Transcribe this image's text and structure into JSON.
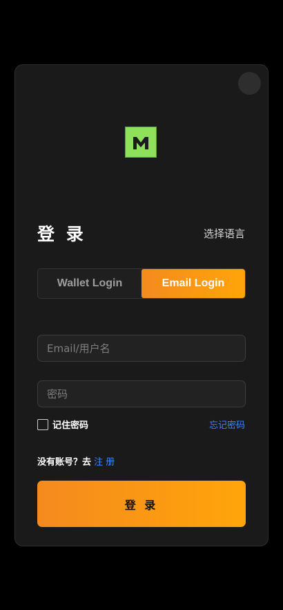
{
  "header": {
    "title": "登 录",
    "language_label": "选择语言"
  },
  "tabs": [
    {
      "label": "Wallet Login",
      "active": false
    },
    {
      "label": "Email Login",
      "active": true
    }
  ],
  "form": {
    "email_placeholder": "Email/用户名",
    "email_value": "",
    "password_placeholder": "密码",
    "password_value": "",
    "remember_label": "记住密码",
    "remember_checked": false,
    "forgot_label": "忘记密码"
  },
  "signup": {
    "prompt": "没有账号？去",
    "link_label": "注 册"
  },
  "submit_label": "登 录",
  "colors": {
    "accent_start": "#f58a1f",
    "accent_end": "#ffa50a",
    "link": "#3f86ff",
    "logo": "#8fe05a"
  },
  "icons": {
    "logo": "m-logo-icon",
    "close": "close-icon"
  }
}
